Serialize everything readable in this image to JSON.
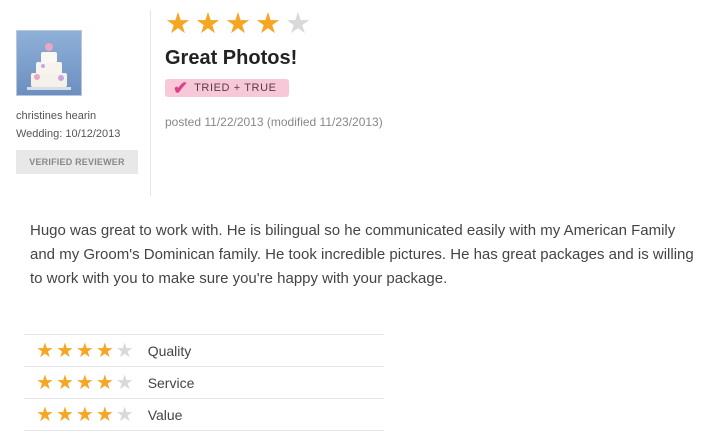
{
  "reviewer": {
    "name": "christines hearin",
    "wedding": "Wedding: 10/12/2013",
    "verified_label": "VERIFIED REVIEWER"
  },
  "review": {
    "overall_rating": 4,
    "max_rating": 5,
    "title": "Great Photos!",
    "badge_label": "TRIED + TRUE",
    "posted": "posted 11/22/2013 (modified 11/23/2013)",
    "body": "Hugo was great to work with. He is bilingual so he communicated easily with my American Family and my Groom's Dominican family. He took incredible pictures. He has great packages and is willing to work with you to make sure you're happy with your package."
  },
  "ratings": [
    {
      "label": "Quality",
      "value": 4
    },
    {
      "label": "Service",
      "value": 4
    },
    {
      "label": "Value",
      "value": 4
    }
  ],
  "colors": {
    "star_on": "#f5a623",
    "star_off": "#d9d9d9",
    "badge_bg": "#f7c8d8",
    "badge_check": "#e0408a"
  },
  "icons": {
    "star": "star-icon",
    "check": "check-icon",
    "avatar": "wedding-cake-avatar"
  }
}
